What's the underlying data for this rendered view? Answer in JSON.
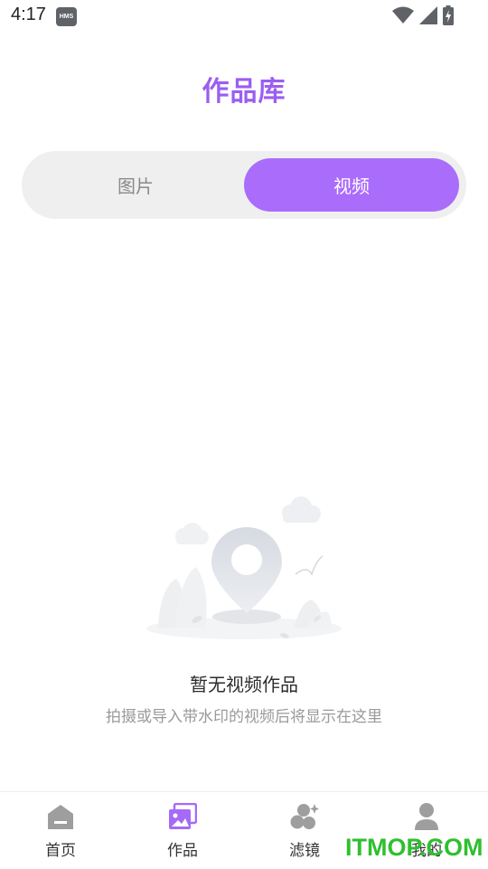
{
  "status_bar": {
    "time": "4:17",
    "hms_badge": "HMS",
    "icons": [
      "wifi-icon",
      "signal-icon",
      "battery-charging-icon"
    ]
  },
  "header": {
    "title": "作品库"
  },
  "tabs": [
    {
      "label": "图片",
      "active": false
    },
    {
      "label": "视频",
      "active": true
    }
  ],
  "empty_state": {
    "title": "暂无视频作品",
    "description": "拍摄或导入带水印的视频后将显示在这里"
  },
  "bottom_nav": [
    {
      "label": "首页",
      "icon": "home-icon",
      "active": false
    },
    {
      "label": "作品",
      "icon": "gallery-icon",
      "active": true
    },
    {
      "label": "滤镜",
      "icon": "filter-icon",
      "active": false
    },
    {
      "label": "我的",
      "icon": "profile-icon",
      "active": false
    }
  ],
  "watermark": "ITMOP.COM",
  "colors": {
    "accent": "#aa6cfb",
    "title": "#9a5ef2",
    "inactive_icon": "#9e9e9e",
    "watermark": "#2fbf2f"
  }
}
